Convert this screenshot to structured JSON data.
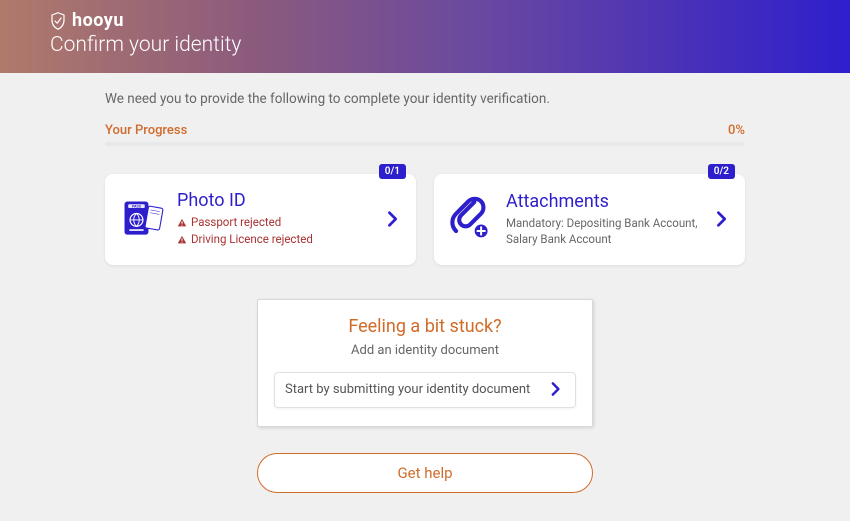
{
  "header": {
    "brand": "hooyu",
    "title": "Confirm your identity"
  },
  "instruction": "We need you to provide the following to complete your identity verification.",
  "progress": {
    "label": "Your Progress",
    "value": "0%"
  },
  "cards": {
    "photo_id": {
      "title": "Photo ID",
      "badge": "0/1",
      "errors": [
        "Passport rejected",
        "Driving Licence rejected"
      ]
    },
    "attachments": {
      "title": "Attachments",
      "badge": "0/2",
      "desc": "Mandatory: Depositing Bank Account, Salary Bank Account"
    }
  },
  "stuck": {
    "title": "Feeling a bit stuck?",
    "sub": "Add an identity document",
    "action": "Start by submitting your identity document"
  },
  "help": {
    "label": "Get help"
  }
}
